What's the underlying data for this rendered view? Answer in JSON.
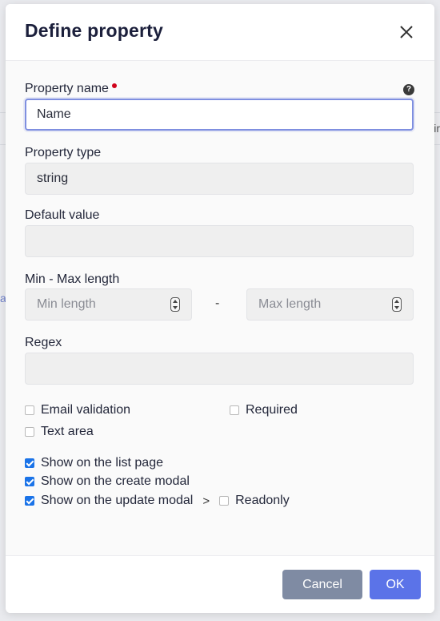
{
  "modal": {
    "title": "Define property",
    "close_icon": "close-icon"
  },
  "form": {
    "property_name": {
      "label": "Property name",
      "value": "Name",
      "required": true,
      "help_icon": "question-circle-icon"
    },
    "property_type": {
      "label": "Property type",
      "value": "string"
    },
    "default_value": {
      "label": "Default value",
      "value": ""
    },
    "min_max": {
      "label": "Min - Max length",
      "min_placeholder": "Min length",
      "max_placeholder": "Max length",
      "separator": "-"
    },
    "regex": {
      "label": "Regex",
      "value": ""
    },
    "checkboxes": {
      "email_validation": {
        "label": "Email validation",
        "checked": false
      },
      "required": {
        "label": "Required",
        "checked": false
      },
      "text_area": {
        "label": "Text area",
        "checked": false
      },
      "show_list": {
        "label": "Show on the list page",
        "checked": true
      },
      "show_create": {
        "label": "Show on the create modal",
        "checked": true
      },
      "show_update": {
        "label": "Show on the update modal",
        "checked": true
      },
      "readonly": {
        "label": "Readonly",
        "checked": false
      }
    },
    "arrow": ">"
  },
  "footer": {
    "cancel_label": "Cancel",
    "ok_label": "OK"
  },
  "background": {
    "edge_text_right": "ir",
    "edge_text_left": "al"
  },
  "colors": {
    "primary": "#5b73e8",
    "secondary": "#7f8ba3",
    "required_dot": "#d0021b",
    "checkbox_checked": "#1a73e8"
  }
}
